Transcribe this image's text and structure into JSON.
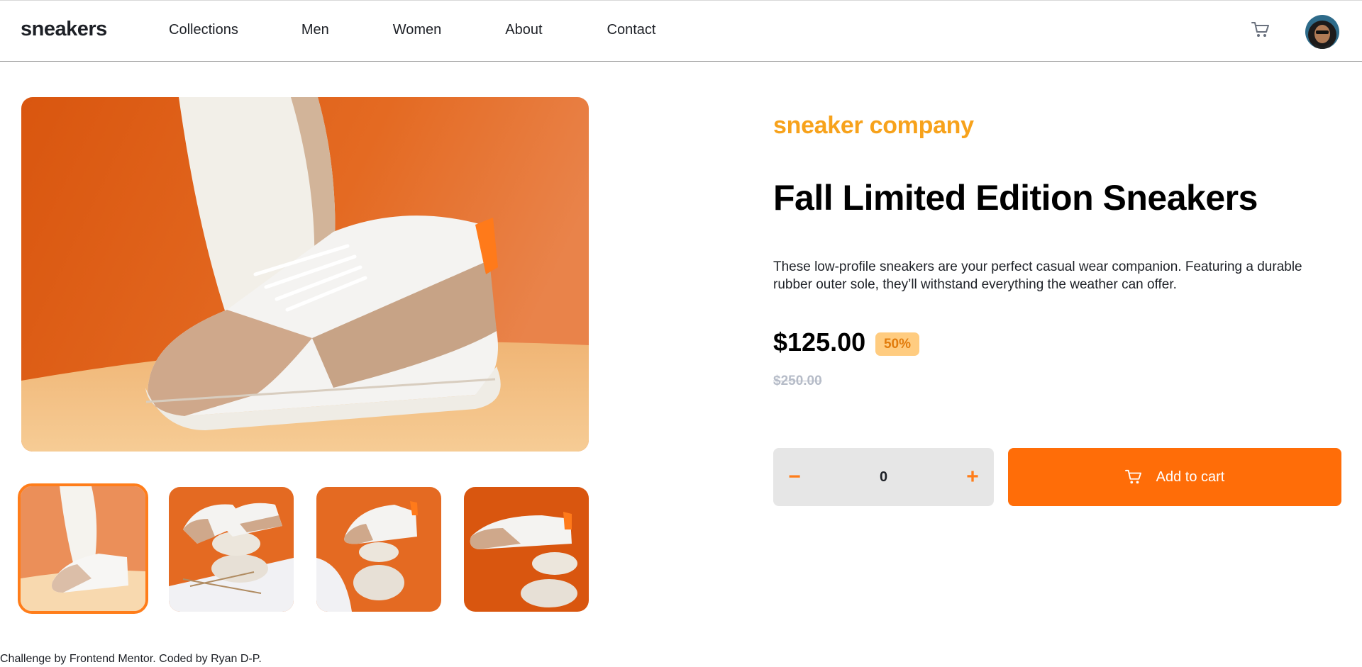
{
  "header": {
    "logo": "sneakers",
    "nav": [
      "Collections",
      "Men",
      "Women",
      "About",
      "Contact"
    ],
    "cart_icon": "cart-icon",
    "avatar_icon": "avatar"
  },
  "gallery": {
    "thumbnails": 4,
    "active_thumbnail": 1
  },
  "product": {
    "brand": "sneaker company",
    "title": "Fall Limited Edition Sneakers",
    "description": "These low-profile sneakers are your perfect casual wear companion. Featuring a durable rubber outer sole, they’ll withstand everything the weather can offer.",
    "price": "$125.00",
    "discount": "50%",
    "old_price": "$250.00",
    "quantity": "0",
    "minus_label": "−",
    "plus_label": "+",
    "add_to_cart_label": "Add to cart"
  },
  "footer": {
    "credit": "Challenge by Frontend Mentor. Coded by Ryan D-P."
  },
  "colors": {
    "accent": "#ff6d08",
    "brand": "#f7a21b",
    "discount_bg": "#ffcc80",
    "qty_bg": "#e6e6e6"
  }
}
